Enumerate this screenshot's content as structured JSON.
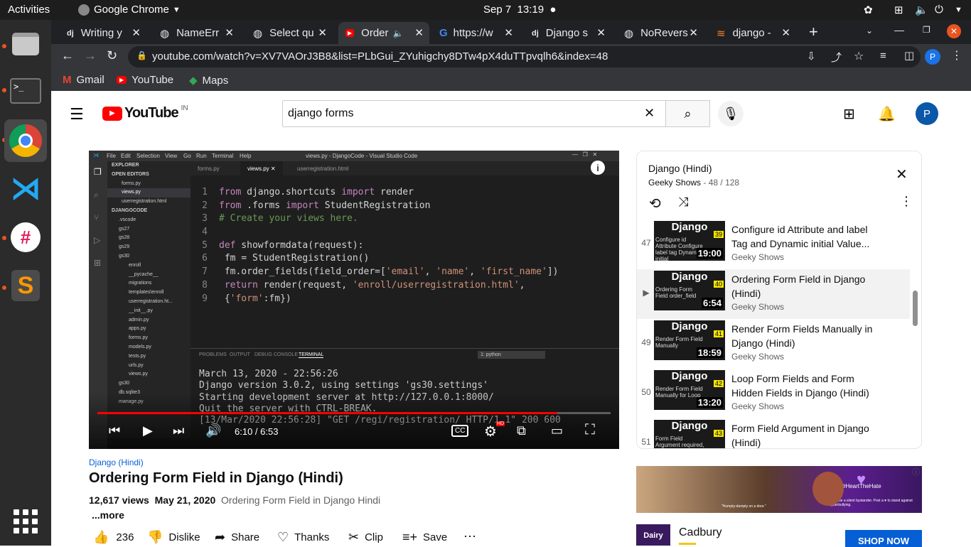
{
  "topbar": {
    "activities": "Activities",
    "app": "Google Chrome",
    "date": "Sep 7",
    "time": "13:19"
  },
  "tabs": [
    {
      "label": "Writing y",
      "icon": "django-favicon"
    },
    {
      "label": "NameErr",
      "icon": "globe-favicon"
    },
    {
      "label": "Select qu",
      "icon": "globe-favicon"
    },
    {
      "label": "Order",
      "icon": "youtube-favicon"
    },
    {
      "label": "https://w",
      "icon": "google-favicon"
    },
    {
      "label": "Django s",
      "icon": "django-favicon"
    },
    {
      "label": "NoRevers",
      "icon": "globe-favicon"
    },
    {
      "label": "django - ",
      "icon": "stackoverflow-favicon"
    }
  ],
  "url": "youtube.com/watch?v=XV7VAOrJ3B8&list=PLbGui_ZYuhigchy8DTw4pX4duTTpvqlh6&index=48",
  "profile_initial": "P",
  "bookmarks": [
    {
      "label": "Gmail"
    },
    {
      "label": "YouTube"
    },
    {
      "label": "Maps"
    }
  ],
  "yt": {
    "logo_text": "YouTube",
    "region": "IN",
    "search_value": "django forms",
    "avatar": "P"
  },
  "video": {
    "time": "6:10 / 6:53",
    "progress_fraction": 0.896,
    "channel_tag": "Django (Hindi)",
    "title": "Ordering Form Field in Django (Hindi)",
    "views": "12,617 views",
    "date": "May 21, 2020",
    "desc": "Ordering Form Field in Django Hindi",
    "more": "...more",
    "likes": "236",
    "dislike": "Dislike",
    "share": "Share",
    "thanks": "Thanks",
    "clip": "Clip",
    "save": "Save",
    "code_lines": [
      "from django.shortcuts import render",
      "from .forms import StudentRegistration",
      "# Create your views here.",
      "",
      "def showformdata(request):",
      " fm = StudentRegistration()",
      " fm.order_fields(field_order=['email', 'name', 'first_name'])",
      " return render(request, 'enroll/userregistration.html',",
      " {'form':fm})"
    ],
    "terminal_lines": [
      "March 13, 2020 - 22:56:26",
      "Django version 3.0.2, using settings 'gs30.settings'",
      "Starting development server at http://127.0.0.1:8000/",
      "Quit the server with CTRL-BREAK.",
      "[13/Mar/2020 22:56:28] \"GET /regi/registration/ HTTP/1.1\" 200 600"
    ],
    "vscode_title": "views.py - DjangoCode - Visual Studio Code",
    "vscode_menu": [
      "File",
      "Edit",
      "Selection",
      "View",
      "Go",
      "Run",
      "Terminal",
      "Help"
    ],
    "vscode_tabs": [
      "forms.py",
      "views.py",
      "userregistration.html"
    ],
    "explorer": [
      "EXPLORER",
      "OPEN EDITORS",
      "forms.py",
      "views.py",
      "userregistration.html",
      "DJANGOCODE",
      ".vscode",
      "gs27",
      "gs28",
      "gs29",
      "gs30",
      "enroll",
      "__pycache__",
      "migrations",
      "templates\\enroll",
      "userregistration.ht...",
      "__init__.py",
      "admin.py",
      "apps.py",
      "forms.py",
      "models.py",
      "tests.py",
      "urls.py",
      "views.py",
      "gs30",
      "db.sqlite3",
      "manage.py"
    ],
    "panel_tabs": [
      "PROBLEMS",
      "OUTPUT",
      "DEBUG CONSOLE",
      "TERMINAL"
    ],
    "panel_select": "1: python"
  },
  "playlist": {
    "title": "Django (Hindi)",
    "channel": "Geeky Shows",
    "position": "48 / 128",
    "items": [
      {
        "idx": "47",
        "title": "Configure id Attribute and label Tag and Dynamic initial Value...",
        "channel": "Geeky Shows",
        "dur": "19:00",
        "num": "39",
        "thumb": "Configure id Attribute Configure label tag Dynamic initial"
      },
      {
        "idx": "▶",
        "title": "Ordering Form Field in Django (Hindi)",
        "channel": "Geeky Shows",
        "dur": "6:54",
        "num": "40",
        "thumb": "Ordering Form Field order_field"
      },
      {
        "idx": "49",
        "title": "Render Form Fields Manually in Django (Hindi)",
        "channel": "Geeky Shows",
        "dur": "18:59",
        "num": "41",
        "thumb": "Render Form Field Manually"
      },
      {
        "idx": "50",
        "title": "Loop Form Fields and Form Hidden Fields in Django (Hindi)",
        "channel": "Geeky Shows",
        "dur": "13:20",
        "num": "42",
        "thumb": "Render Form Field Manually for Loop"
      },
      {
        "idx": "51",
        "title": "Form Field Argument in Django (Hindi)",
        "channel": "Geeky Shows",
        "dur": "",
        "num": "43",
        "thumb": "Form Field Argument required, label"
      }
    ]
  },
  "ad": {
    "brand": "Cadbury",
    "cta": "SHOP NOW",
    "banner_text": "#HeartTheHate",
    "banner_sub": "Don't be a silent bystander. Post a ♥ to stand against cyberbullying.",
    "quote": "\"Humpty-dumpty on a door.\""
  },
  "colors": {
    "yt_red": "#ff0000",
    "chrome_dark": "#202124",
    "ubuntu_orange": "#e95420",
    "shop_blue": "#065fd4"
  }
}
